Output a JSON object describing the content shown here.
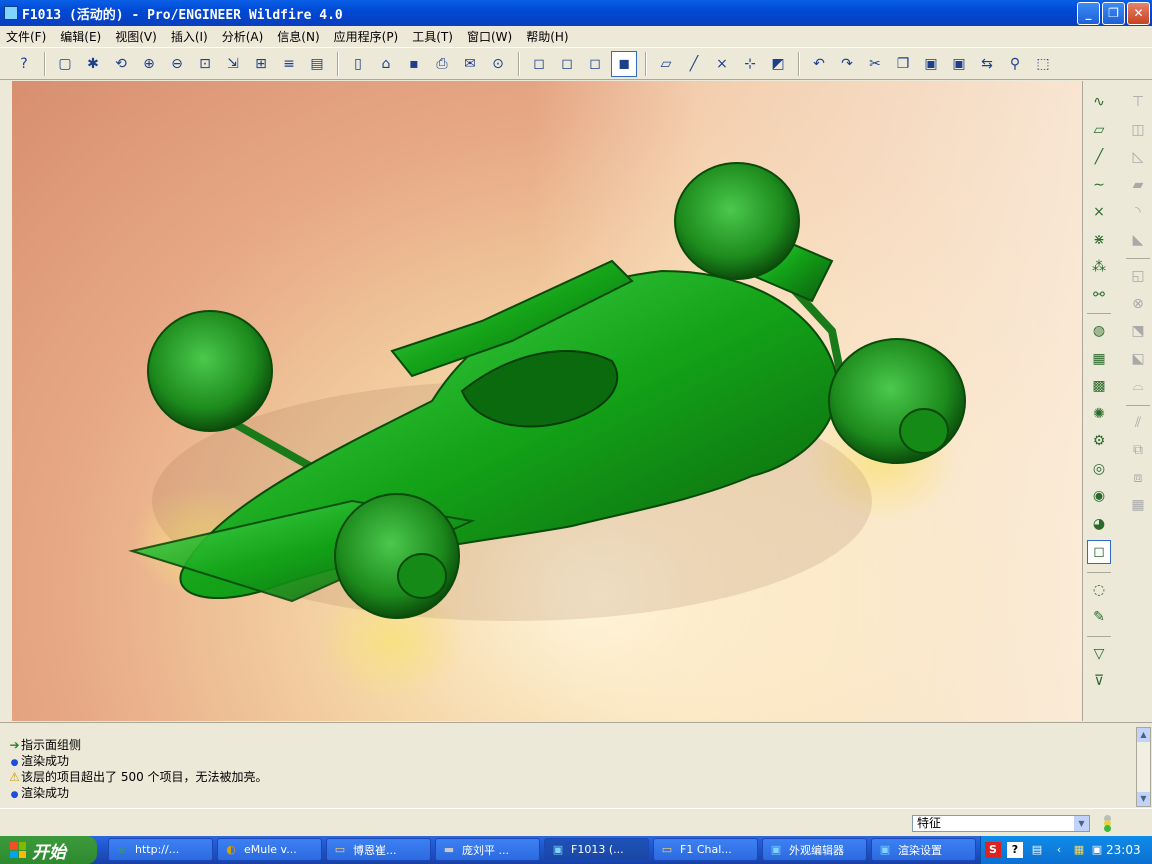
{
  "window": {
    "title": "F1013 (活动的) - Pro/ENGINEER Wildfire 4.0",
    "min_label": "_",
    "max_label": "❐",
    "close_label": "✕"
  },
  "menu": [
    "文件(F)",
    "编辑(E)",
    "视图(V)",
    "插入(I)",
    "分析(A)",
    "信息(N)",
    "应用程序(P)",
    "工具(T)",
    "窗口(W)",
    "帮助(H)"
  ],
  "toolbar": {
    "groups": [
      [
        "context-help-icon"
      ],
      [
        "repaint-icon",
        "spin-center-icon",
        "orient-mode-icon",
        "zoom-in-icon",
        "zoom-out-icon",
        "refit-icon",
        "reorient-icon",
        "saved-views-icon",
        "layers-icon",
        "view-manager-icon"
      ],
      [
        "new-file-icon",
        "open-file-icon",
        "save-icon",
        "print-icon",
        "email-icon",
        "email-link-icon"
      ],
      [
        "wireframe-icon",
        "hidden-line-icon",
        "no-hidden-icon",
        "shading-icon"
      ],
      [
        "datum-planes-icon",
        "datum-axes-icon",
        "datum-points-icon",
        "coordinate-systems-icon",
        "annotations-icon"
      ],
      [
        "undo-icon",
        "redo-icon",
        "cut-icon",
        "copy-icon",
        "paste-icon",
        "paste-special-icon",
        "regenerate-icon",
        "find-icon",
        "selection-box-icon"
      ]
    ],
    "active_icon": "shading-icon"
  },
  "right_toolbar": {
    "col1": [
      "sketched-curve-icon",
      "datum-plane-icon",
      "datum-axis-icon",
      "datum-curve-icon",
      "datum-point-icon",
      "point-offset-icon",
      "point-field-icon",
      "analysis-feature-icon",
      "|",
      "appearance-icon",
      "scene-icon",
      "room-editor-icon",
      "light-icon",
      "render-settings-icon",
      "render-region-icon",
      "render-window-icon",
      "render-icon",
      "shading-display-icon",
      "|",
      "spotlight-icon",
      "enhanced-realism-icon",
      "|",
      "select-filter-icon",
      "smart-select-icon"
    ],
    "col2": [
      "hole-icon",
      "shell-icon",
      "rib-icon",
      "draft-icon",
      "round-icon",
      "chamfer-icon",
      "|",
      "extrude-icon",
      "revolve-icon",
      "sweep-icon",
      "blend-icon",
      "boundary-blend-icon",
      "|",
      "mirror-icon",
      "merge-icon",
      "trim-icon",
      "pattern-icon"
    ],
    "col1_active": "shading-display-icon"
  },
  "messages": [
    {
      "type": "ok",
      "icon": "➔",
      "text": "指示面组侧"
    },
    {
      "type": "info",
      "icon": "●",
      "text": "渲染成功"
    },
    {
      "type": "warn",
      "icon": "⚠",
      "text": "该层的项目超出了 500 个项目，无法被加亮。"
    },
    {
      "type": "info",
      "icon": "●",
      "text": "渲染成功"
    }
  ],
  "status": {
    "filter_value": "特征",
    "filter_dropdown": "▼"
  },
  "taskbar": {
    "start_label": "开始",
    "items": [
      {
        "label": "http://...",
        "icon": "e",
        "color": "#36a240"
      },
      {
        "label": "eMule v...",
        "icon": "◐",
        "color": "#d9a000"
      },
      {
        "label": "博恩崔...",
        "icon": "▭",
        "color": "#f5d070"
      },
      {
        "label": "庞刘平 ...",
        "icon": "▬",
        "color": "#c8c8c8"
      },
      {
        "label": "F1013 (...",
        "icon": "▣",
        "color": "#7fd3ff",
        "active": true
      },
      {
        "label": "F1 Chal...",
        "icon": "▭",
        "color": "#f5d070"
      },
      {
        "label": "外观编辑器",
        "icon": "▣",
        "color": "#7fd3ff"
      },
      {
        "label": "渲染设置",
        "icon": "▣",
        "color": "#7fd3ff"
      }
    ],
    "tray": {
      "ime_label": "S",
      "help_label": "?",
      "clock": "23:03"
    }
  }
}
